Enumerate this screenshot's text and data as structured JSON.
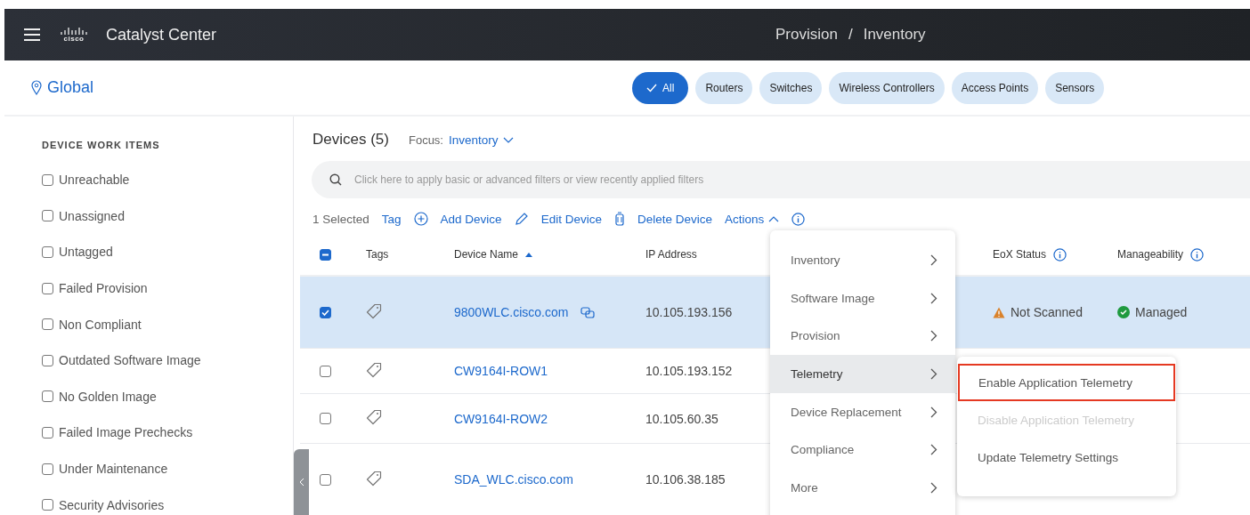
{
  "header": {
    "logo_text": "cisco",
    "title": "Catalyst Center",
    "breadcrumb": [
      "Provision",
      "Inventory"
    ],
    "separator": "/"
  },
  "location": "Global",
  "filters": [
    {
      "label": "All",
      "selected": true
    },
    {
      "label": "Routers",
      "selected": false
    },
    {
      "label": "Switches",
      "selected": false
    },
    {
      "label": "Wireless Controllers",
      "selected": false
    },
    {
      "label": "Access Points",
      "selected": false
    },
    {
      "label": "Sensors",
      "selected": false
    }
  ],
  "sidebar": {
    "heading": "DEVICE WORK ITEMS",
    "items": [
      {
        "label": "Unreachable",
        "checked": false
      },
      {
        "label": "Unassigned",
        "checked": false
      },
      {
        "label": "Untagged",
        "checked": false
      },
      {
        "label": "Failed Provision",
        "checked": false
      },
      {
        "label": "Non Compliant",
        "checked": false
      },
      {
        "label": "Outdated Software Image",
        "checked": false
      },
      {
        "label": "No Golden Image",
        "checked": false
      },
      {
        "label": "Failed Image Prechecks",
        "checked": false
      },
      {
        "label": "Under Maintenance",
        "checked": false
      },
      {
        "label": "Security Advisories",
        "checked": false
      }
    ]
  },
  "devices": {
    "title": "Devices (5)",
    "focus_label": "Focus:",
    "focus_value": "Inventory"
  },
  "search": {
    "placeholder": "Click here to apply basic or advanced filters or view recently applied filters"
  },
  "toolbar": {
    "selected_count": "1 Selected",
    "actions": [
      {
        "label": "Tag",
        "kind": "plain"
      },
      {
        "label": "Add Device",
        "kind": "add"
      },
      {
        "label": "Edit Device",
        "kind": "edit"
      },
      {
        "label": "Delete Device",
        "kind": "delete"
      },
      {
        "label": "Actions",
        "kind": "menu",
        "expanded": true
      }
    ]
  },
  "table": {
    "select_all_partial": true,
    "columns": [
      {
        "label": "Tags",
        "sorted": false,
        "info": false
      },
      {
        "label": "Device Name",
        "sorted": true,
        "info": false
      },
      {
        "label": "IP Address",
        "sorted": false,
        "info": false
      },
      {
        "label": "EoX Status",
        "sorted": false,
        "info": true
      },
      {
        "label": "Manageability",
        "sorted": false,
        "info": true
      }
    ],
    "rows": [
      {
        "selected": true,
        "name": "9800WLC.cisco.com",
        "copy": true,
        "ip": "10.105.193.156",
        "eox": {
          "text": "Not Scanned",
          "kind": "warning"
        },
        "manageability": {
          "text": "Managed",
          "kind": "ok"
        }
      },
      {
        "selected": false,
        "name": "CW9164I-ROW1",
        "copy": false,
        "ip": "10.105.193.152"
      },
      {
        "selected": false,
        "name": "CW9164I-ROW2",
        "copy": false,
        "ip": "10.105.60.35"
      },
      {
        "selected": false,
        "name": "SDA_WLC.cisco.com",
        "copy": false,
        "ip": "10.106.38.185"
      }
    ]
  },
  "actions_menu": [
    {
      "label": "Inventory",
      "selected": false
    },
    {
      "label": "Software Image",
      "selected": false
    },
    {
      "label": "Provision",
      "selected": false
    },
    {
      "label": "Telemetry",
      "selected": true
    },
    {
      "label": "Device Replacement",
      "selected": false
    },
    {
      "label": "Compliance",
      "selected": false
    },
    {
      "label": "More",
      "selected": false
    }
  ],
  "submenu": [
    {
      "label": "Enable Application Telemetry",
      "disabled": false,
      "highlighted": true
    },
    {
      "label": "Disable Application Telemetry",
      "disabled": true,
      "highlighted": false
    },
    {
      "label": "Update Telemetry Settings",
      "disabled": false,
      "highlighted": false
    }
  ]
}
